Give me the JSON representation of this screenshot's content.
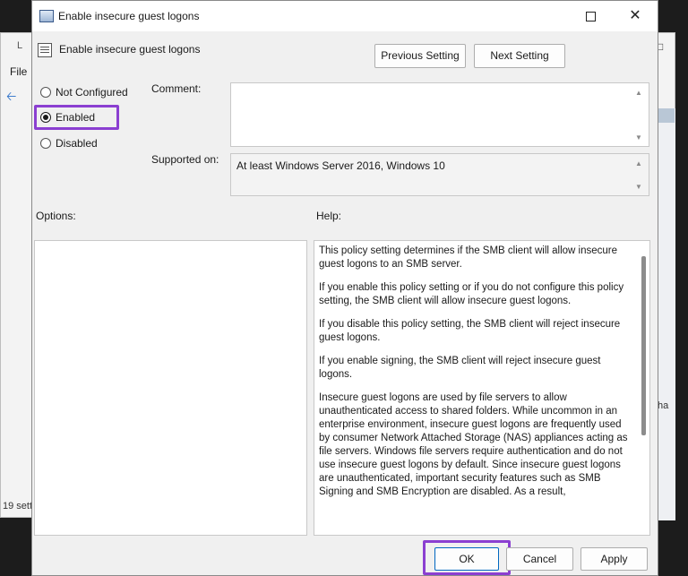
{
  "background_window": {
    "title_fragment": "L",
    "menu_file": "File",
    "status_fragment": "19 sett",
    "right_fragment": "ha"
  },
  "dialog": {
    "title": "Enable insecure guest logons",
    "header": "Enable insecure guest logons",
    "nav": {
      "previous": "Previous Setting",
      "next": "Next Setting"
    },
    "state": {
      "options": [
        {
          "label": "Not Configured",
          "selected": false
        },
        {
          "label": "Enabled",
          "selected": true
        },
        {
          "label": "Disabled",
          "selected": false
        }
      ]
    },
    "comment_label": "Comment:",
    "comment_value": "",
    "supported_label": "Supported on:",
    "supported_value": "At least Windows Server 2016, Windows 10",
    "options_label": "Options:",
    "help_label": "Help:",
    "help_paragraphs": [
      "This policy setting determines if the SMB client will allow insecure guest logons to an SMB server.",
      "If you enable this policy setting or if you do not configure this policy setting, the SMB client will allow insecure guest logons.",
      "If you disable this policy setting, the SMB client will reject insecure guest logons.",
      "If you enable signing, the SMB client will reject insecure guest logons.",
      "Insecure guest logons are used by file servers to allow unauthenticated access to shared folders. While uncommon in an enterprise environment, insecure guest logons are frequently used by consumer Network Attached Storage (NAS) appliances acting as file servers. Windows file servers require authentication and do not use insecure guest logons by default. Since insecure guest logons are unauthenticated, important security features such as SMB Signing and SMB Encryption are disabled. As a result,"
    ],
    "buttons": {
      "ok": "OK",
      "cancel": "Cancel",
      "apply": "Apply"
    }
  },
  "highlight_color": "#8b3fd1",
  "icons": {
    "back": "back-arrow-icon",
    "close": "close-icon",
    "maximize": "maximize-icon",
    "policy": "policy-setting-icon"
  }
}
